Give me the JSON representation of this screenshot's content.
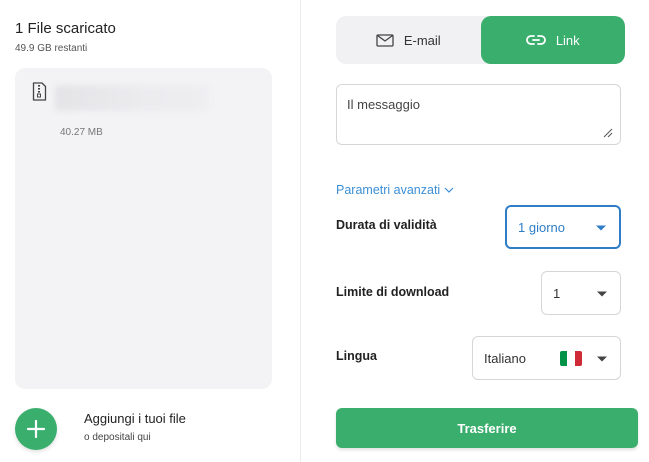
{
  "left_panel": {
    "title": "1 File scaricato",
    "remaining": "49.9 GB restanti",
    "file": {
      "size": "40.27 MB",
      "icon": "file-zip-icon"
    },
    "add": {
      "title": "Aggiungi i tuoi file",
      "subtitle": "o depositali qui",
      "icon": "plus-icon"
    }
  },
  "right_panel": {
    "tabs": [
      {
        "label": "E-mail",
        "icon": "mail-icon",
        "active": false
      },
      {
        "label": "Link",
        "icon": "link-icon",
        "active": true
      }
    ],
    "message": {
      "placeholder": "Il messaggio",
      "value": ""
    },
    "advanced_label": "Parametri avanzati",
    "validity": {
      "label": "Durata di validità",
      "value": "1 giorno"
    },
    "download_limit": {
      "label": "Limite di download",
      "value": "1"
    },
    "language": {
      "label": "Lingua",
      "value": "Italiano",
      "flag": [
        "#009246",
        "#ffffff",
        "#ce2b37"
      ]
    },
    "submit_label": "Trasferire"
  },
  "colors": {
    "accent_green": "#3aae6d",
    "link_blue": "#3d8fd6",
    "focus_blue": "#2f7dc7"
  }
}
